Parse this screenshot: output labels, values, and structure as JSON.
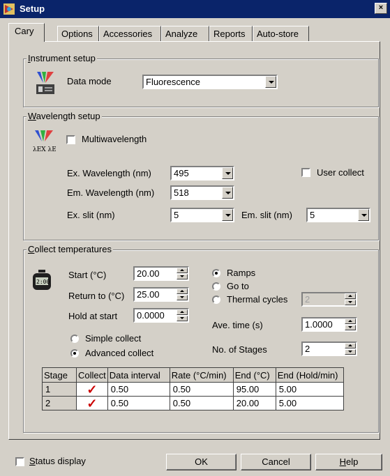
{
  "window": {
    "title": "Setup",
    "close": "×"
  },
  "tabs": [
    {
      "label": "Cary"
    },
    {
      "label": "Options"
    },
    {
      "label": "Accessories"
    },
    {
      "label": "Analyze"
    },
    {
      "label": "Reports"
    },
    {
      "label": "Auto-store"
    }
  ],
  "instrument": {
    "group_label_u": "I",
    "group_label_rest": "nstrument setup",
    "data_mode_label": "Data mode",
    "data_mode_value": "Fluorescence"
  },
  "wavelength": {
    "group_label_u": "W",
    "group_label_rest": "avelength setup",
    "icon_text": "λEX λEM",
    "multiwavelength_label": "Multiwavelength",
    "ex_wavelength_label": "Ex. Wavelength (nm)",
    "ex_wavelength_value": "495",
    "em_wavelength_label": "Em. Wavelength (nm)",
    "em_wavelength_value": "518",
    "user_collect_label": "User collect",
    "ex_slit_label": "Ex. slit (nm)",
    "ex_slit_value": "5",
    "em_slit_label": "Em. slit (nm)",
    "em_slit_value": "5"
  },
  "temperatures": {
    "group_label_u": "C",
    "group_label_rest": "ollect temperatures",
    "icon_text": "2:00",
    "start_label": "Start (°C)",
    "start_value": "20.00",
    "return_label": "Return to (°C)",
    "return_value": "25.00",
    "hold_label": "Hold at start",
    "hold_value": "0.0000",
    "simple_collect": "Simple collect",
    "advanced_collect": "Advanced collect",
    "ramps": "Ramps",
    "go_to": "Go to",
    "thermal_cycles": "Thermal cycles",
    "thermal_cycles_value": "2",
    "ave_time_label": "Ave. time (s)",
    "ave_time_value": "1.0000",
    "stages_label": "No. of Stages",
    "stages_value": "2",
    "table": {
      "headers": [
        "Stage",
        "Collect",
        "Data interval",
        "Rate (°C/min)",
        "End (°C)",
        "End (Hold/min)"
      ],
      "rows": [
        [
          "1",
          "✓",
          "0.50",
          "0.50",
          "95.00",
          "5.00"
        ],
        [
          "2",
          "✓",
          "0.50",
          "0.50",
          "20.00",
          "5.00"
        ]
      ]
    }
  },
  "footer": {
    "status_display_u": "S",
    "status_display_rest": "tatus display",
    "ok": "OK",
    "cancel": "Cancel",
    "help_u": "H",
    "help_rest": "elp"
  }
}
